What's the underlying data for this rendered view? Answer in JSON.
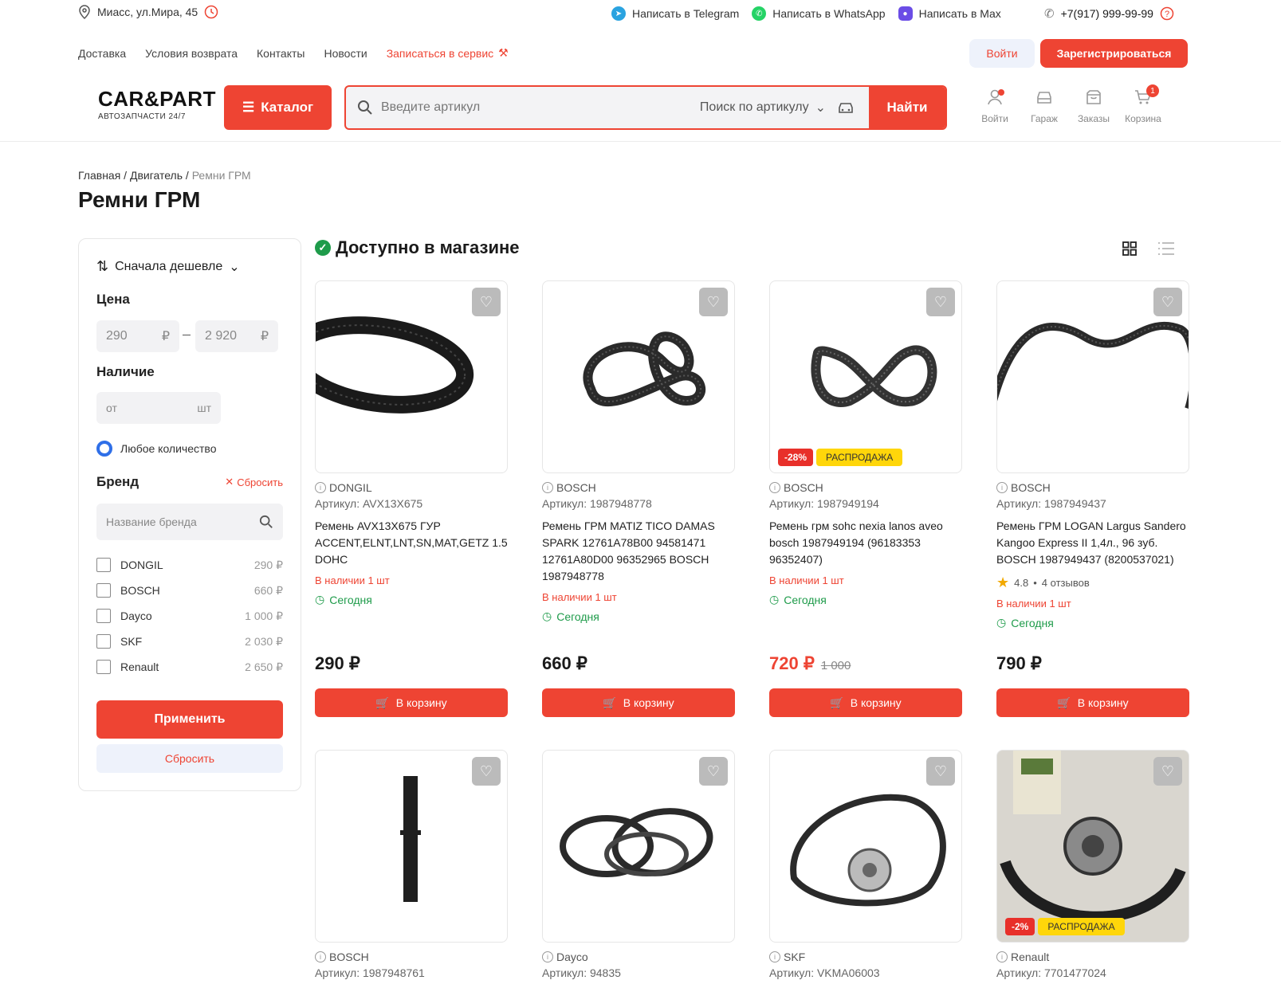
{
  "topbar": {
    "address": "Миасс, ул.Мира, 45",
    "telegram": "Написать в Telegram",
    "whatsapp": "Написать в WhatsApp",
    "max": "Написать в Max",
    "phone": "+7(917) 999-99-99"
  },
  "nav": {
    "items": [
      "Доставка",
      "Условия возврата",
      "Контакты",
      "Новости"
    ],
    "service": "Записаться в сервис",
    "login": "Войти",
    "register": "Зарегистрироваться"
  },
  "header": {
    "logo": "CAR&PART",
    "logo_sub": "АВТОЗАПЧАСТИ 24/7",
    "catalog": "Каталог",
    "search_placeholder": "Введите артикул",
    "search_mode": "Поиск по артикулу",
    "search_button": "Найти",
    "icons": [
      {
        "label": "Войти",
        "icon": "user-icon"
      },
      {
        "label": "Гараж",
        "icon": "car-icon"
      },
      {
        "label": "Заказы",
        "icon": "box-icon"
      },
      {
        "label": "Корзина",
        "icon": "cart-icon",
        "badge": "1"
      }
    ]
  },
  "breadcrumb": {
    "home": "Главная",
    "sep": " / ",
    "parent": "Двигатель",
    "current": "Ремни ГРМ"
  },
  "page_title": "Ремни ГРМ",
  "filters": {
    "sort": "Сначала дешевле",
    "price_label": "Цена",
    "price_from": "290",
    "price_to": "2 920",
    "currency": "₽",
    "stock_label": "Наличие",
    "stock_from": "от",
    "stock_unit": "шт",
    "any_qty": "Любое количество",
    "brand_label": "Бренд",
    "brand_reset": "Сбросить",
    "brand_placeholder": "Название бренда",
    "brands": [
      {
        "name": "DONGIL",
        "price": "290 ₽"
      },
      {
        "name": "BOSCH",
        "price": "660 ₽"
      },
      {
        "name": "Dayco",
        "price": "1 000 ₽"
      },
      {
        "name": "SKF",
        "price": "2 030 ₽"
      },
      {
        "name": "Renault",
        "price": "2 650 ₽"
      }
    ],
    "apply": "Применить",
    "reset": "Сбросить"
  },
  "section_title": "Доступно в магазине",
  "cart_label": "В корзину",
  "products": [
    {
      "brand": "DONGIL",
      "sku": "Артикул: AVX13X675",
      "name": "Ремень AVX13X675 ГУР ACCENT,ELNT,LNT,SN,MAT,GETZ 1.5 DOHC",
      "stock": "В наличии 1 шт",
      "when": "Сегодня",
      "price": "290 ₽"
    },
    {
      "brand": "BOSCH",
      "sku": "Артикул: 1987948778",
      "name": "Ремень ГРМ MATIZ TICO DAMAS SPARK 12761A78B00 94581471 12761A80D00 96352965 BOSCH 1987948778",
      "stock": "В наличии 1 шт",
      "when": "Сегодня",
      "price": "660 ₽"
    },
    {
      "brand": "BOSCH",
      "sku": "Артикул: 1987949194",
      "name": "Ремень грм sohc nexia lanos aveo bosch 1987949194 (96183353 96352407)",
      "stock": "В наличии 1 шт",
      "when": "Сегодня",
      "price": "720 ₽",
      "old_price": "1 000",
      "discount": "-28%",
      "promo": "РАСПРОДАЖА"
    },
    {
      "brand": "BOSCH",
      "sku": "Артикул: 1987949437",
      "name": "Ремень ГРМ LOGAN Largus Sandero Kangoo Express II 1,4л., 96 зуб. BOSCH 1987949437 (8200537021)",
      "rating": "4.8",
      "reviews": "4 отзывов",
      "stock": "В наличии 1 шт",
      "when": "Сегодня",
      "price": "790 ₽"
    },
    {
      "brand": "BOSCH",
      "sku": "Артикул: 1987948761"
    },
    {
      "brand": "Dayco",
      "sku": "Артикул: 94835"
    },
    {
      "brand": "SKF",
      "sku": "Артикул: VKMA06003"
    },
    {
      "brand": "Renault",
      "sku": "Артикул: 7701477024",
      "discount": "-2%",
      "promo": "РАСПРОДАЖА"
    }
  ],
  "colors": {
    "accent": "#ee4433",
    "green": "#1e9b4a",
    "promo": "#ffd60a"
  }
}
